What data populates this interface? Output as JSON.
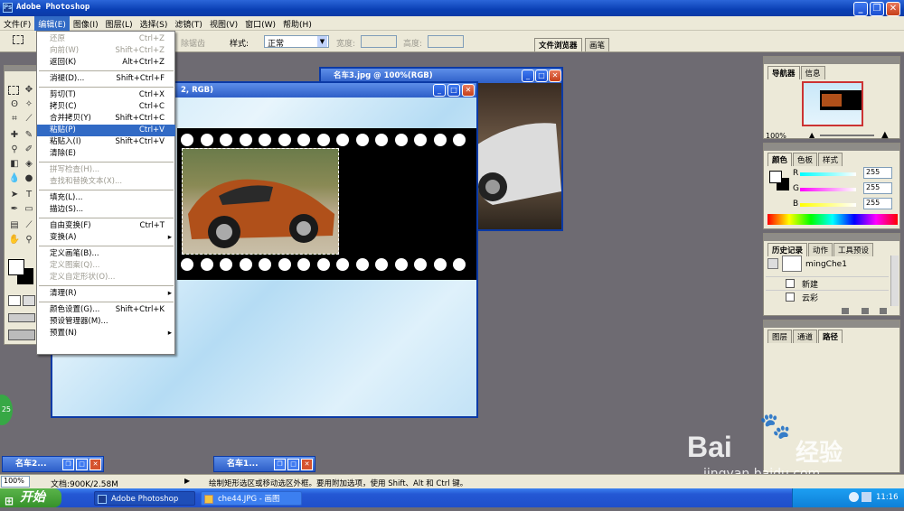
{
  "app": {
    "title": "Adobe Photoshop"
  },
  "menubar": {
    "items": [
      "文件(F)",
      "编辑(E)",
      "图像(I)",
      "图层(L)",
      "选择(S)",
      "滤镜(T)",
      "视图(V)",
      "窗口(W)",
      "帮助(H)"
    ],
    "active_index": 1
  },
  "options": {
    "feather_text": "除锯齿",
    "style_label": "样式:",
    "style_value": "正常",
    "width_label": "宽度:",
    "height_label": "高度:",
    "tab_browser": "文件浏览器",
    "tab_brush": "画笔"
  },
  "edit_menu": [
    {
      "label": "还原",
      "key": "Ctrl+Z",
      "disabled": true
    },
    {
      "label": "向前(W)",
      "key": "Shift+Ctrl+Z",
      "disabled": true
    },
    {
      "label": "返回(K)",
      "key": "Alt+Ctrl+Z",
      "disabled": false
    },
    {
      "sep": true
    },
    {
      "label": "消褪(D)...",
      "key": "Shift+Ctrl+F",
      "disabled": false
    },
    {
      "sep": true
    },
    {
      "label": "剪切(T)",
      "key": "Ctrl+X"
    },
    {
      "label": "拷贝(C)",
      "key": "Ctrl+C"
    },
    {
      "label": "合并拷贝(Y)",
      "key": "Shift+Ctrl+C"
    },
    {
      "label": "粘贴(P)",
      "key": "Ctrl+V",
      "selected": true
    },
    {
      "label": "粘贴入(I)",
      "key": "Shift+Ctrl+V"
    },
    {
      "label": "清除(E)",
      "key": ""
    },
    {
      "sep": true
    },
    {
      "label": "拼写检查(H)...",
      "key": "",
      "disabled": true
    },
    {
      "label": "查找和替换文本(X)...",
      "key": "",
      "disabled": true
    },
    {
      "sep": true
    },
    {
      "label": "填充(L)...",
      "key": ""
    },
    {
      "label": "描边(S)...",
      "key": ""
    },
    {
      "sep": true
    },
    {
      "label": "自由变换(F)",
      "key": "Ctrl+T"
    },
    {
      "label": "变换(A)",
      "key": "",
      "submenu": true
    },
    {
      "sep": true
    },
    {
      "label": "定义画笔(B)...",
      "key": ""
    },
    {
      "label": "定义图案(Q)...",
      "key": "",
      "disabled": true
    },
    {
      "label": "定义自定形状(O)...",
      "key": "",
      "disabled": true
    },
    {
      "sep": true
    },
    {
      "label": "清理(R)",
      "key": "",
      "submenu": true
    },
    {
      "sep": true
    },
    {
      "label": "颜色设置(G)...",
      "key": "Shift+Ctrl+K"
    },
    {
      "label": "预设管理器(M)...",
      "key": ""
    },
    {
      "label": "预置(N)",
      "key": "",
      "submenu": true
    }
  ],
  "documents": {
    "main_title": "2, RGB)",
    "car3_title": "名车3.jpg @ 100%(RGB)",
    "min1": "名车2...",
    "min2": "名车1..."
  },
  "navigator": {
    "tabs": [
      "导航器",
      "信息"
    ],
    "zoom": "100%"
  },
  "color": {
    "tabs": [
      "颜色",
      "色板",
      "样式"
    ],
    "r_label": "R",
    "g_label": "G",
    "b_label": "B",
    "r": "255",
    "g": "255",
    "b": "255"
  },
  "history": {
    "tabs": [
      "历史记录",
      "动作",
      "工具预设"
    ],
    "snapshot": "mingChe1",
    "items": [
      "新建",
      "云彩"
    ]
  },
  "layers": {
    "tabs": [
      "图层",
      "通道",
      "路径"
    ]
  },
  "status": {
    "zoom": "100%",
    "doc": "文档:900K/2.58M",
    "hint": "绘制矩形选区或移动选区外框。要用附加选项，使用 Shift、Alt 和 Ctrl 键。"
  },
  "taskbar": {
    "start": "开始",
    "task1": "Adobe Photoshop",
    "task2": "che44.JPG - 画图",
    "time": "11:16"
  },
  "side_badge": "25",
  "watermark": {
    "brand": "Bai",
    "brand2": "经验",
    "url": "jingyan.baidu.com"
  }
}
